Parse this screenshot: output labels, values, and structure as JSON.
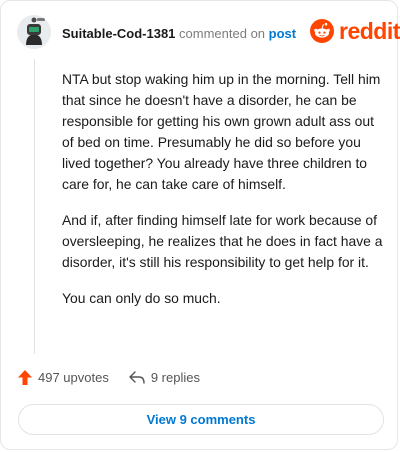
{
  "comment": {
    "author": "Suitable-Cod-1381",
    "action_text": "commented on",
    "post_link": "post",
    "paragraphs": [
      "NTA but stop waking him up in the morning. Tell him that since he doesn't have a disorder, he can be responsible for getting his own grown adult ass out of bed on time. Presumably he did so before you lived together? You already have three children to care for, he can take care of himself.",
      "And if, after finding himself late for work because of oversleeping, he realizes that he does in fact have a disorder, it's still his responsibility to get help for it.",
      "You can only do so much."
    ]
  },
  "brand": {
    "name": "reddit",
    "color": "#ff4500",
    "icon": "reddit-alien-icon"
  },
  "footer": {
    "upvotes": "497 upvotes",
    "replies": "9 replies",
    "view_comments": "View 9 comments",
    "upvote_icon": "upvote-arrow-icon",
    "reply_icon": "reply-arrow-icon",
    "accent": "#0079d3"
  }
}
